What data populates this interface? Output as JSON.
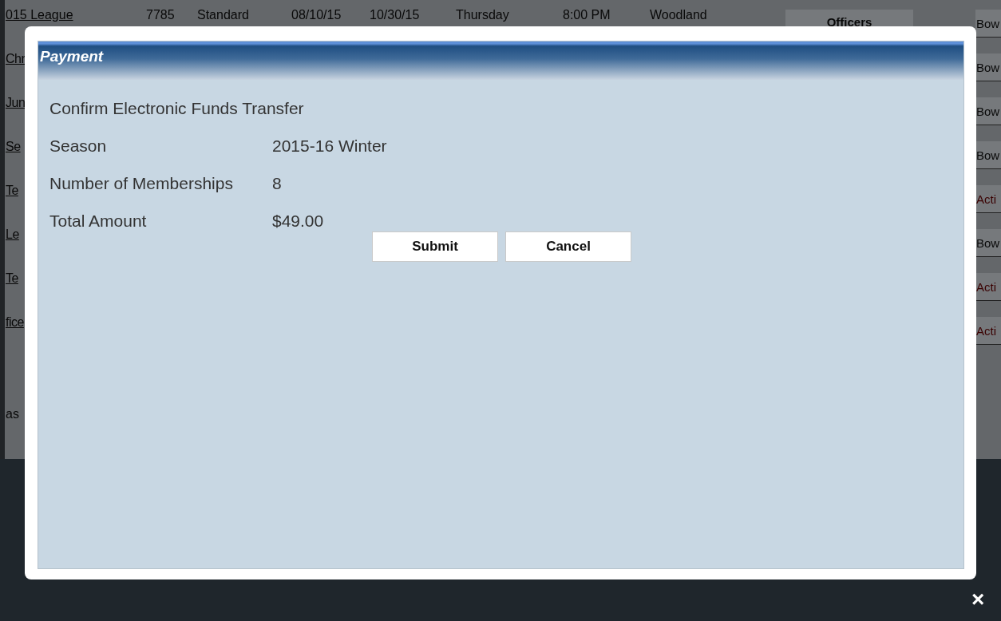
{
  "background_table": {
    "rows": [
      {
        "cells": [
          "015 League",
          "7785",
          "Standard",
          "08/10/15",
          "10/30/15",
          "Thursday",
          "8:00 PM",
          "Woodland"
        ],
        "button": "Officers",
        "action": {
          "label": "Bow",
          "kind": "normal"
        }
      },
      {
        "cells": [
          "Chr"
        ],
        "action": {
          "label": "Bow",
          "kind": "normal"
        }
      },
      {
        "cells": [
          "Jun"
        ],
        "action": {
          "label": "Bow",
          "kind": "normal"
        }
      },
      {
        "cells": [
          "Se"
        ],
        "action": {
          "label": "Bow",
          "kind": "normal"
        }
      },
      {
        "cells": [
          "Te"
        ],
        "action": {
          "label": "Acti",
          "kind": "alert"
        }
      },
      {
        "cells": [
          "Le"
        ],
        "action": {
          "label": "Bow",
          "kind": "normal"
        }
      },
      {
        "cells": [
          "Te"
        ],
        "action": {
          "label": "Acti",
          "kind": "alert"
        }
      },
      {
        "cells": [
          "fice"
        ],
        "action": {
          "label": "Acti",
          "kind": "alert"
        }
      }
    ],
    "footnote": "as"
  },
  "dialog": {
    "title": "Payment",
    "heading": "Confirm Electronic Funds Transfer",
    "fields": [
      {
        "label": "Season",
        "value": "2015-16 Winter"
      },
      {
        "label": "Number of Memberships",
        "value": "8"
      },
      {
        "label": "Total Amount",
        "value": "$49.00"
      }
    ],
    "buttons": [
      "Submit",
      "Cancel"
    ]
  },
  "close": "×"
}
